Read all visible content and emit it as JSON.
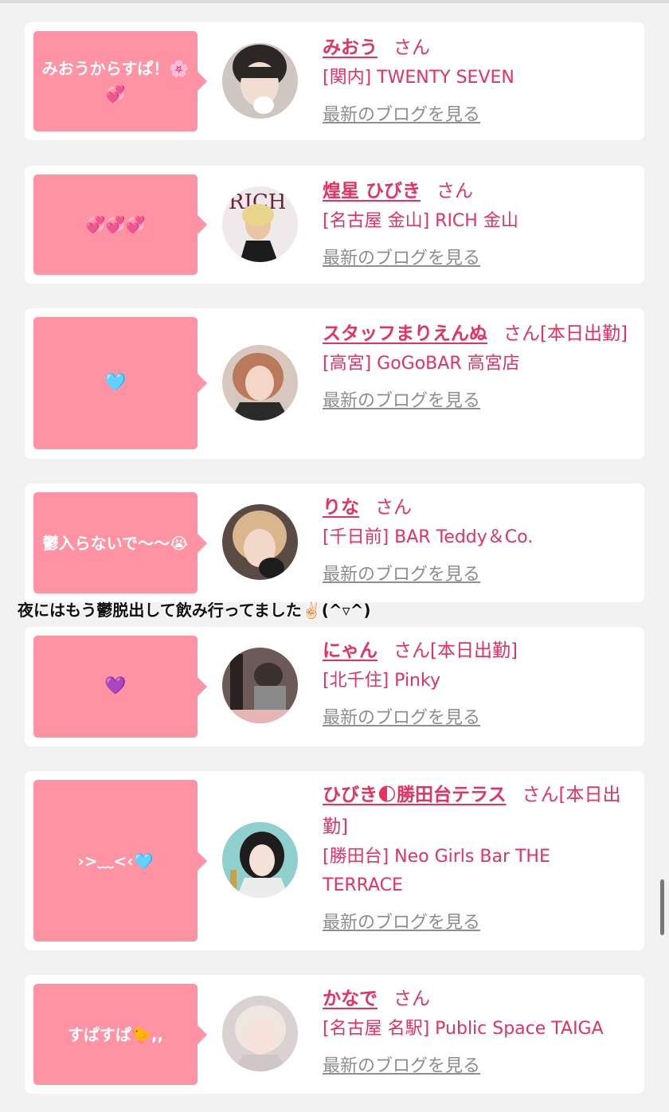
{
  "colors": {
    "accent": "#e8315e",
    "bubble": "#ff92a3",
    "link_gray": "#8e8e8e"
  },
  "overlay_text": "夜にはもう鬱脱出して飲み行ってました✌🏻(^▿^)",
  "blog_label": "最新のブログを見る",
  "cards": [
    {
      "bubble": "みおうからすぱ！🌸💞",
      "name": "みおう",
      "suffix": "さん",
      "shop": "[関内] TWENTY SEVEN"
    },
    {
      "bubble": "💞💞💞",
      "name": "煌星 ひびき",
      "suffix": "さん",
      "shop": "[名古屋 金山] RICH 金山"
    },
    {
      "bubble": "🩵",
      "name": "スタッフまりえんぬ",
      "suffix": "さん[本日出勤]",
      "shop": "[高宮] GoGoBAR 高宮店"
    },
    {
      "bubble": "鬱入らないで〜〜😭",
      "name": "りな",
      "suffix": "さん",
      "shop": "[千日前] BAR Teddy＆Co."
    },
    {
      "bubble": "💜",
      "name": "にゃん",
      "suffix": "さん[本日出勤]",
      "shop": "[北千住] Pinky"
    },
    {
      "bubble": "›>﹏<‹🩵",
      "name": "ひびき🌓勝田台テラス",
      "suffix": "さん[本日出勤]",
      "shop": "[勝田台] Neo Girls Bar THE TERRACE"
    },
    {
      "bubble": "すぱすぱ🐤,,",
      "name": "かなで",
      "suffix": "さん",
      "shop": "[名古屋 名駅] Public Space TAIGA"
    }
  ]
}
